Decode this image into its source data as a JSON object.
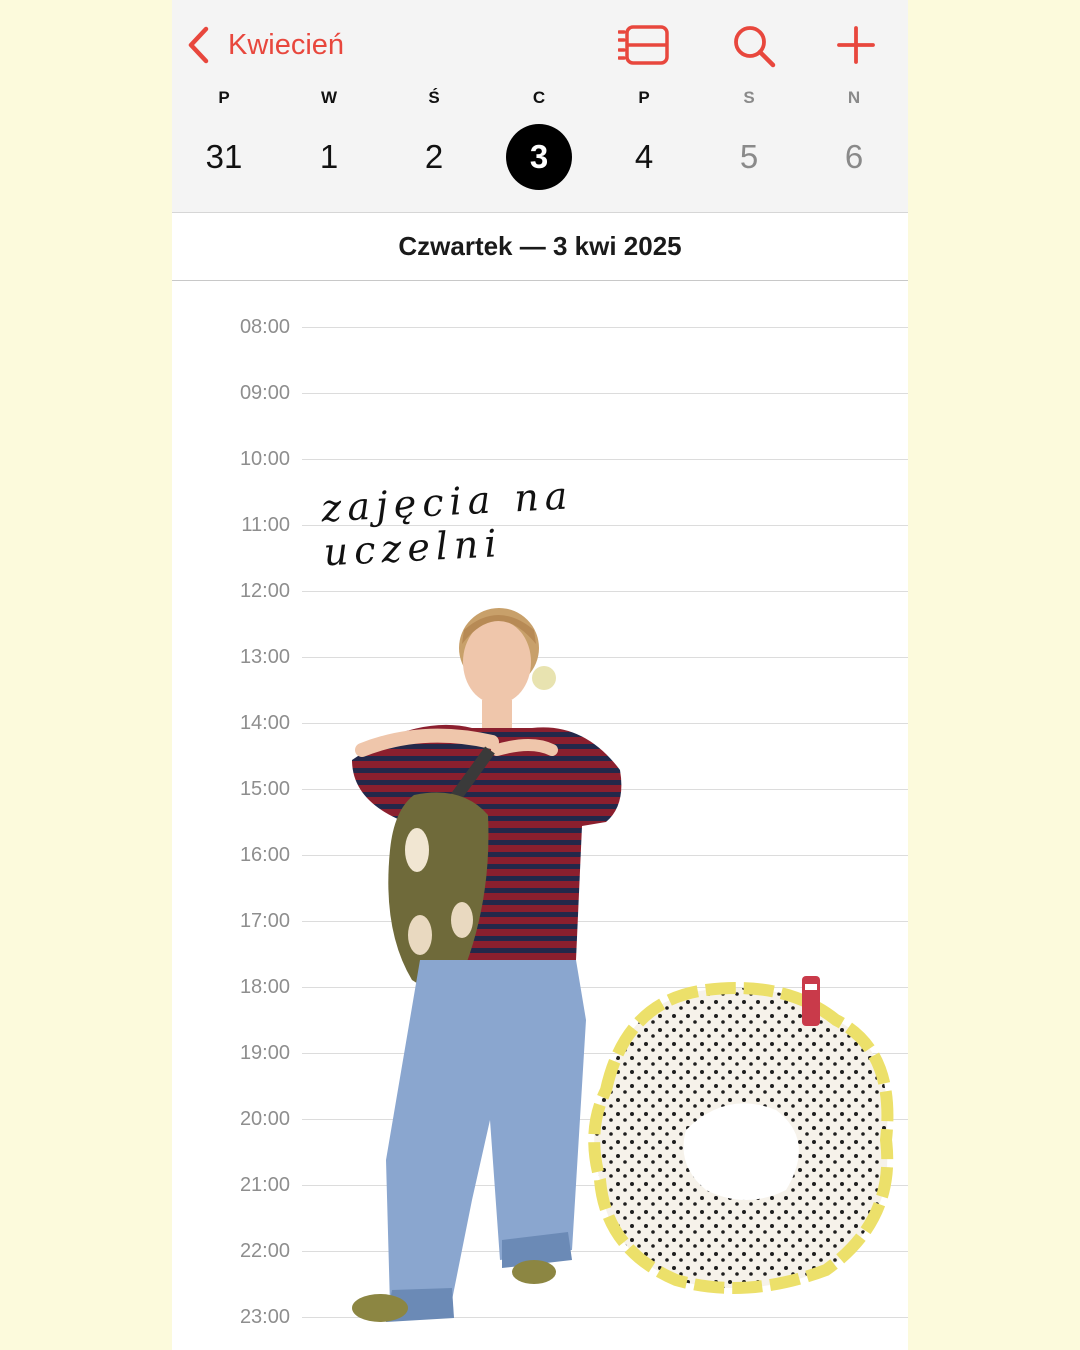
{
  "header": {
    "back_label": "Kwiecień",
    "icons": {
      "back": "chevron-left-icon",
      "list": "list-view-icon",
      "search": "search-icon",
      "add": "plus-icon"
    },
    "accent_color": "#e8473d"
  },
  "week": {
    "days": [
      {
        "letter": "P",
        "date": "31"
      },
      {
        "letter": "W",
        "date": "1"
      },
      {
        "letter": "Ś",
        "date": "2"
      },
      {
        "letter": "C",
        "date": "3"
      },
      {
        "letter": "P",
        "date": "4"
      },
      {
        "letter": "S",
        "date": "5"
      },
      {
        "letter": "N",
        "date": "6"
      }
    ],
    "selected_index": 3
  },
  "day": {
    "title": "Czwartek — 3 kwi 2025"
  },
  "hours": [
    "08:00",
    "09:00",
    "10:00",
    "11:00",
    "12:00",
    "13:00",
    "14:00",
    "15:00",
    "16:00",
    "17:00",
    "18:00",
    "19:00",
    "20:00",
    "21:00",
    "22:00",
    "23:00"
  ],
  "event": {
    "note": "zajęcia na uczelni"
  }
}
